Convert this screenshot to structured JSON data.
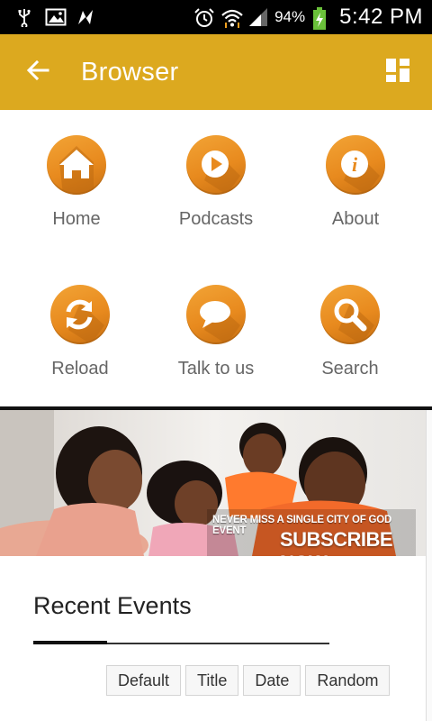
{
  "status_bar": {
    "battery": "94%",
    "time": "5:42 PM",
    "icons": [
      "usb-icon",
      "image-icon",
      "pinwheel-icon",
      "alarm-icon",
      "wifi-icon",
      "signal-icon",
      "battery-charging-icon"
    ]
  },
  "app_bar": {
    "title": "Browser",
    "back_icon": "arrow-left-icon",
    "menu_icon": "dashboard-grid-icon",
    "background": "#dca91f"
  },
  "menu": {
    "items": [
      {
        "label": "Home",
        "icon": "home-icon"
      },
      {
        "label": "Podcasts",
        "icon": "play-icon"
      },
      {
        "label": "About",
        "icon": "info-icon"
      },
      {
        "label": "Reload",
        "icon": "refresh-icon"
      },
      {
        "label": "Talk to us",
        "icon": "chat-bubble-icon"
      },
      {
        "label": "Search",
        "icon": "search-icon"
      }
    ],
    "accent": "#e88a1e"
  },
  "banner": {
    "line1": "NEVER MISS A SINGLE CITY OF GOD EVENT",
    "line2": "SUBSCRIBE NOW"
  },
  "events": {
    "title": "Recent Events",
    "sort_options": [
      "Default",
      "Title",
      "Date",
      "Random"
    ]
  }
}
